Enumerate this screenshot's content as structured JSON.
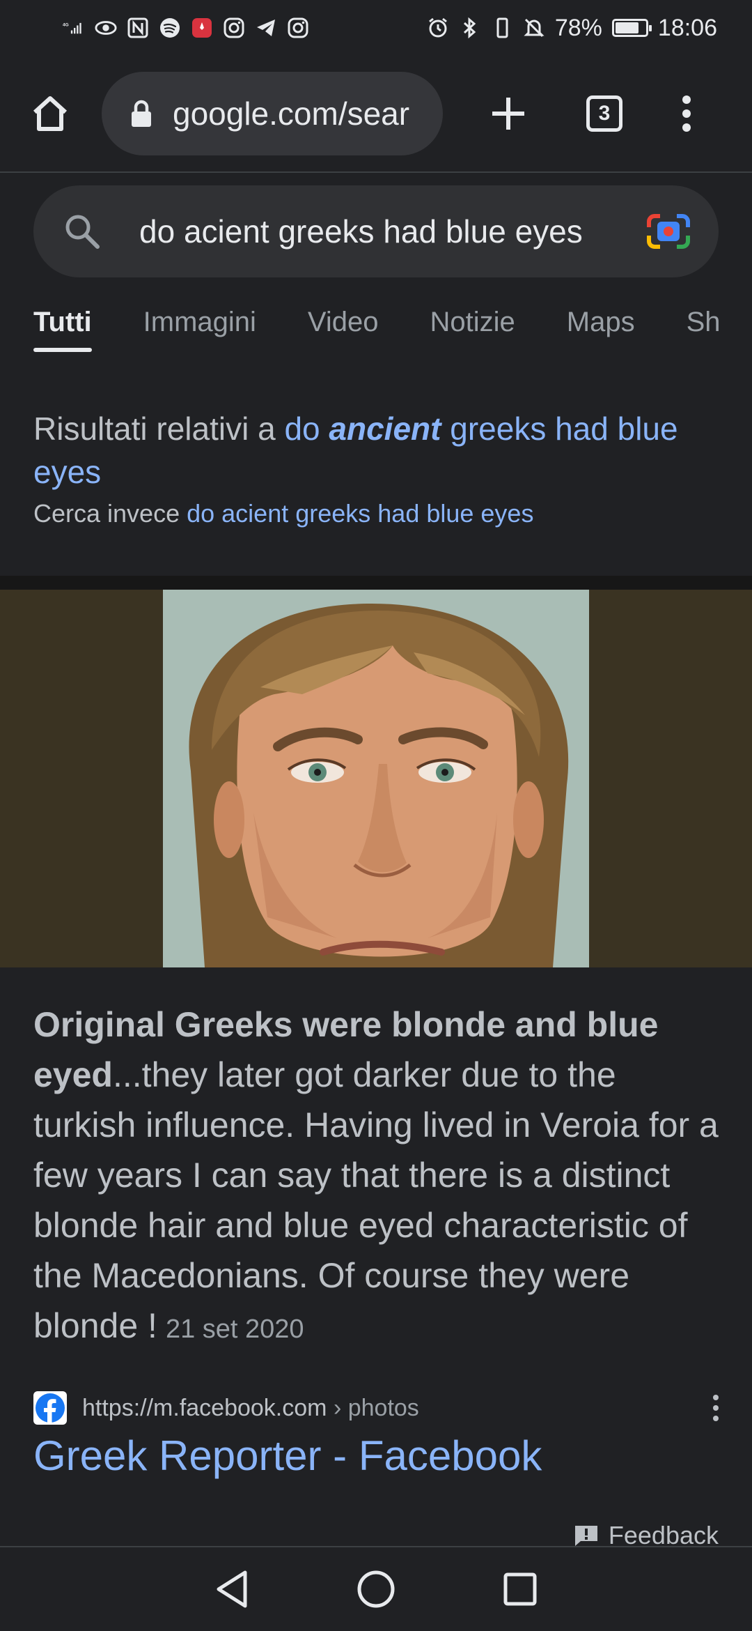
{
  "status_bar": {
    "network": "4G",
    "battery_percent": "78%",
    "battery_level": 0.78,
    "time": "18:06",
    "left_icons": [
      "signal-icon",
      "eye-icon",
      "nfc-icon",
      "spotify-icon",
      "huawei-app-icon",
      "instagram-icon",
      "telegram-icon",
      "instagram-icon"
    ],
    "right_icons": [
      "alarm-icon",
      "bluetooth-icon",
      "vibrate-icon",
      "mute-icon"
    ]
  },
  "browser": {
    "url": "google.com/sear",
    "tab_count": "3"
  },
  "search": {
    "query": "do acient greeks had blue eyes"
  },
  "tabs": [
    "Tutti",
    "Immagini",
    "Video",
    "Notizie",
    "Maps",
    "Sh"
  ],
  "spelling": {
    "prefix": "Risultati relativi a",
    "corrected_before": "do",
    "corrected_emphasis": "ancient",
    "corrected_after": "greeks had blue eyes",
    "instead_prefix": "Cerca invece",
    "instead_query": "do acient greeks had blue eyes"
  },
  "snippet": {
    "bold": "Original Greeks were blonde and blue eyed",
    "text": "...they later got darker due to the turkish influence. Having lived in Veroia for a few years I can say that there is a distinct blonde hair and blue eyed characteristic of the Macedonians. Of course they were blonde !",
    "date": "21 set 2020"
  },
  "result": {
    "url": "https://m.facebook.com",
    "breadcrumb": "› photos",
    "title": "Greek Reporter - Facebook"
  },
  "feedback_label": "Feedback",
  "colors": {
    "background": "#202124",
    "link": "#8ab4f8",
    "text": "#bdc1c6"
  }
}
